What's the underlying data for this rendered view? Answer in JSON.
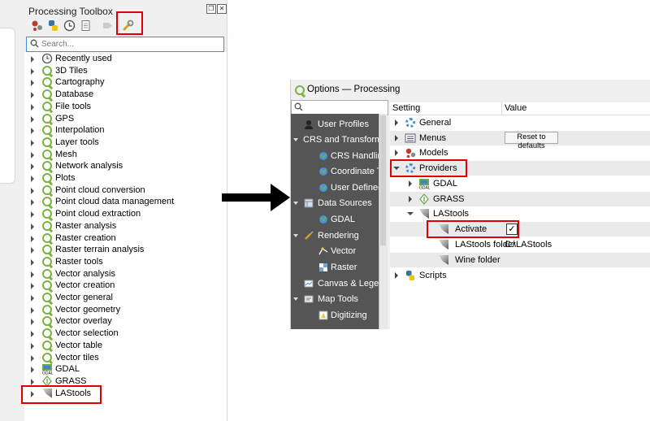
{
  "toolbox": {
    "title": "Processing Toolbox",
    "search_placeholder": "Search...",
    "toolbar_icons": [
      "models-icon",
      "python-icon",
      "history-icon",
      "results-icon",
      "edit-features-icon",
      "options-wrench-icon"
    ],
    "tree_items": [
      {
        "label": "Recently used",
        "icon": "clock-icon"
      },
      {
        "label": "3D Tiles",
        "icon": "qgis-icon"
      },
      {
        "label": "Cartography",
        "icon": "qgis-icon"
      },
      {
        "label": "Database",
        "icon": "qgis-icon"
      },
      {
        "label": "File tools",
        "icon": "qgis-icon"
      },
      {
        "label": "GPS",
        "icon": "qgis-icon"
      },
      {
        "label": "Interpolation",
        "icon": "qgis-icon"
      },
      {
        "label": "Layer tools",
        "icon": "qgis-icon"
      },
      {
        "label": "Mesh",
        "icon": "qgis-icon"
      },
      {
        "label": "Network analysis",
        "icon": "qgis-icon"
      },
      {
        "label": "Plots",
        "icon": "qgis-icon"
      },
      {
        "label": "Point cloud conversion",
        "icon": "qgis-icon"
      },
      {
        "label": "Point cloud data management",
        "icon": "qgis-icon"
      },
      {
        "label": "Point cloud extraction",
        "icon": "qgis-icon"
      },
      {
        "label": "Raster analysis",
        "icon": "qgis-icon"
      },
      {
        "label": "Raster creation",
        "icon": "qgis-icon"
      },
      {
        "label": "Raster terrain analysis",
        "icon": "qgis-icon"
      },
      {
        "label": "Raster tools",
        "icon": "qgis-icon"
      },
      {
        "label": "Vector analysis",
        "icon": "qgis-icon"
      },
      {
        "label": "Vector creation",
        "icon": "qgis-icon"
      },
      {
        "label": "Vector general",
        "icon": "qgis-icon"
      },
      {
        "label": "Vector geometry",
        "icon": "qgis-icon"
      },
      {
        "label": "Vector overlay",
        "icon": "qgis-icon"
      },
      {
        "label": "Vector selection",
        "icon": "qgis-icon"
      },
      {
        "label": "Vector table",
        "icon": "qgis-icon"
      },
      {
        "label": "Vector tiles",
        "icon": "qgis-icon"
      },
      {
        "label": "GDAL",
        "icon": "gdal-icon"
      },
      {
        "label": "GRASS",
        "icon": "grass-icon"
      },
      {
        "label": "LAStools",
        "icon": "lastools-icon"
      }
    ]
  },
  "options": {
    "title": "Options — Processing",
    "sidebar": [
      {
        "label": "User Profiles",
        "icon": "user-icon",
        "level": 0
      },
      {
        "label": "CRS and Transforms",
        "icon": "",
        "level": 0,
        "expanded": true
      },
      {
        "label": "CRS Handling",
        "icon": "globe-icon",
        "level": 1
      },
      {
        "label": "Coordinate Tr",
        "icon": "globe-icon",
        "level": 1
      },
      {
        "label": "User Defined",
        "icon": "globe-icon",
        "level": 1
      },
      {
        "label": "Data Sources",
        "icon": "table-icon",
        "level": 0,
        "expanded": true
      },
      {
        "label": "GDAL",
        "icon": "globe-icon",
        "level": 1
      },
      {
        "label": "Rendering",
        "icon": "brush-icon",
        "level": 0,
        "expanded": true
      },
      {
        "label": "Vector",
        "icon": "vector-icon",
        "level": 1
      },
      {
        "label": "Raster",
        "icon": "raster-icon",
        "level": 1
      },
      {
        "label": "Canvas & Legend",
        "icon": "canvas-icon",
        "level": 0
      },
      {
        "label": "Map Tools",
        "icon": "map-tools-icon",
        "level": 0,
        "expanded": true
      },
      {
        "label": "Digitizing",
        "icon": "digitizing-icon",
        "level": 1
      }
    ],
    "header": {
      "setting": "Setting",
      "value": "Value"
    },
    "rows": [
      {
        "label": "General",
        "icon": "gear-icon",
        "level": 0,
        "arrow": "right",
        "value": ""
      },
      {
        "label": "Menus",
        "icon": "menu-icon",
        "level": 0,
        "arrow": "right",
        "button": "Reset to defaults"
      },
      {
        "label": "Models",
        "icon": "models-icon",
        "level": 0,
        "arrow": "right",
        "value": ""
      },
      {
        "label": "Providers",
        "icon": "gear-icon",
        "level": 0,
        "arrow": "down",
        "value": ""
      },
      {
        "label": "GDAL",
        "icon": "gdal-icon",
        "level": 1,
        "arrow": "right",
        "value": ""
      },
      {
        "label": "GRASS",
        "icon": "grass-icon",
        "level": 1,
        "arrow": "right",
        "value": ""
      },
      {
        "label": "LAStools",
        "icon": "lastools-icon",
        "level": 1,
        "arrow": "down",
        "value": ""
      },
      {
        "label": "Activate",
        "icon": "lastools-icon",
        "level": 2,
        "checkbox": "✓"
      },
      {
        "label": "LAStools folder",
        "icon": "lastools-icon",
        "level": 2,
        "value": "C:\\LAStools"
      },
      {
        "label": "Wine folder",
        "icon": "lastools-icon",
        "level": 2,
        "value": ""
      },
      {
        "label": "Scripts",
        "icon": "python-icon",
        "level": 0,
        "arrow": "right",
        "value": ""
      }
    ]
  },
  "colors": {
    "highlight": "#e00000",
    "qgis_green": "#7bb342",
    "sidebar_bg": "#555555"
  }
}
